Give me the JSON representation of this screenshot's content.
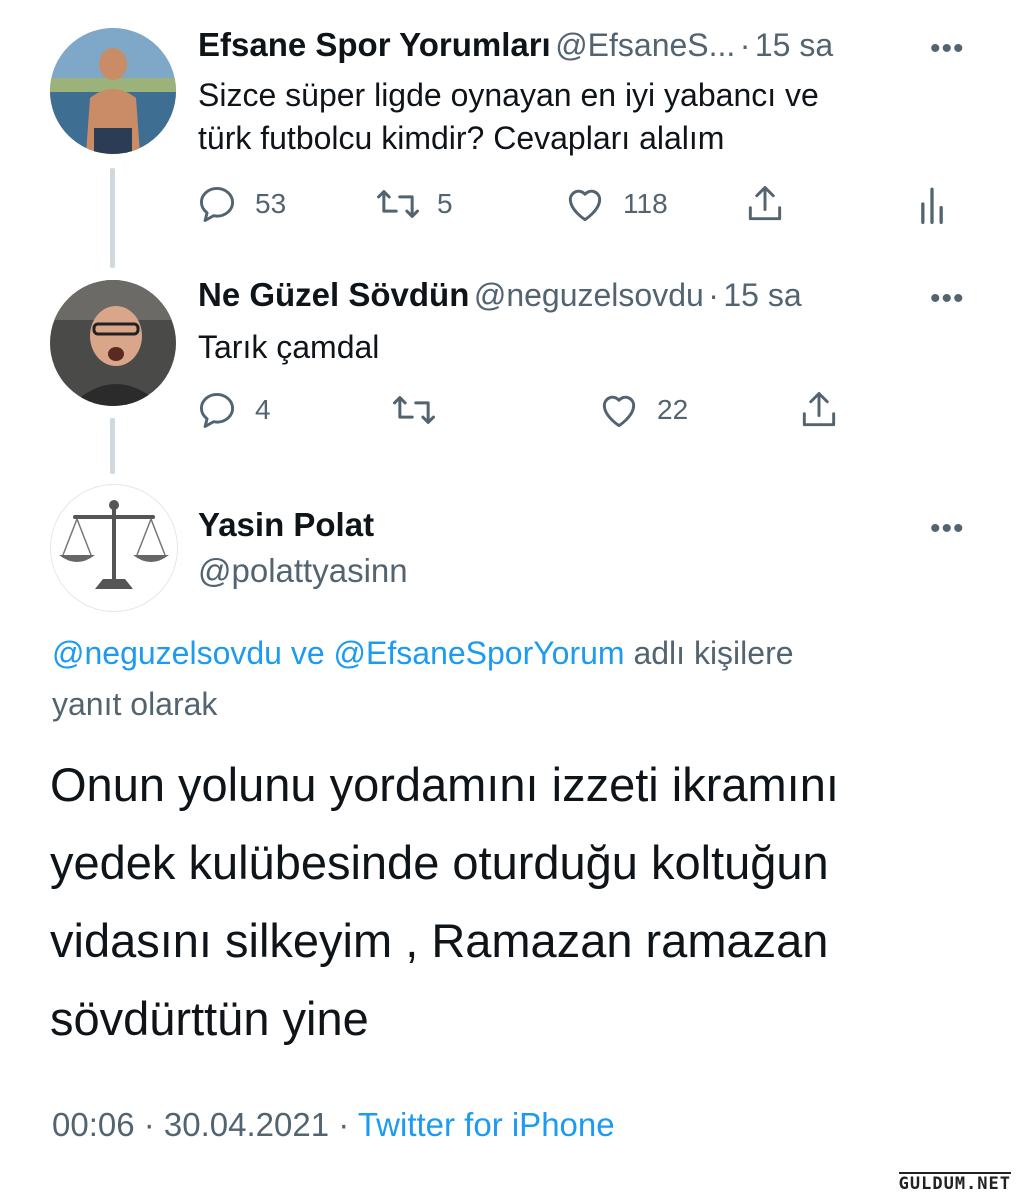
{
  "tweets": [
    {
      "name": "Efsane Spor Yorumları",
      "handle": "@EfsaneS...",
      "dot": "·",
      "time": "15 sa",
      "text_lines": [
        "Sizce süper ligde oynayan en iyi yabancı ve",
        "türk futbolcu kimdir? Cevapları alalım"
      ],
      "replies": "53",
      "retweets": "5",
      "likes": "118",
      "more": "•••"
    },
    {
      "name": "Ne Güzel Sövdün",
      "handle": "@neguzelsovdu",
      "dot": "·",
      "time": "15 sa",
      "text_lines": [
        "Tarık çamdal"
      ],
      "replies": "4",
      "retweets": "",
      "likes": "22",
      "more": "•••"
    }
  ],
  "main_tweet": {
    "name": "Yasin Polat",
    "handle": "@polattyasinn",
    "more": "•••",
    "reply_mention_1": "@neguzelsovdu",
    "reply_connector": " ve ",
    "reply_mention_2": "@EfsaneSporYorum",
    "reply_suffix": " adlı kişilere",
    "reply_suffix_line2": "yanıt olarak",
    "text_lines": [
      "Onun yolunu yordamını izzeti ikramını",
      "yedek kulübesinde oturduğu koltuğun",
      "vidasını silkeyim , Ramazan ramazan",
      "sövdürttün yine"
    ],
    "time": "00:06",
    "dot1": " · ",
    "date": "30.04.2021",
    "dot2": " · ",
    "source": "Twitter for iPhone"
  },
  "watermark": "GULDUM.NET",
  "icons": [
    "reply-icon",
    "retweet-icon",
    "like-icon",
    "share-icon",
    "analytics-icon",
    "more-icon",
    "scales-icon"
  ]
}
